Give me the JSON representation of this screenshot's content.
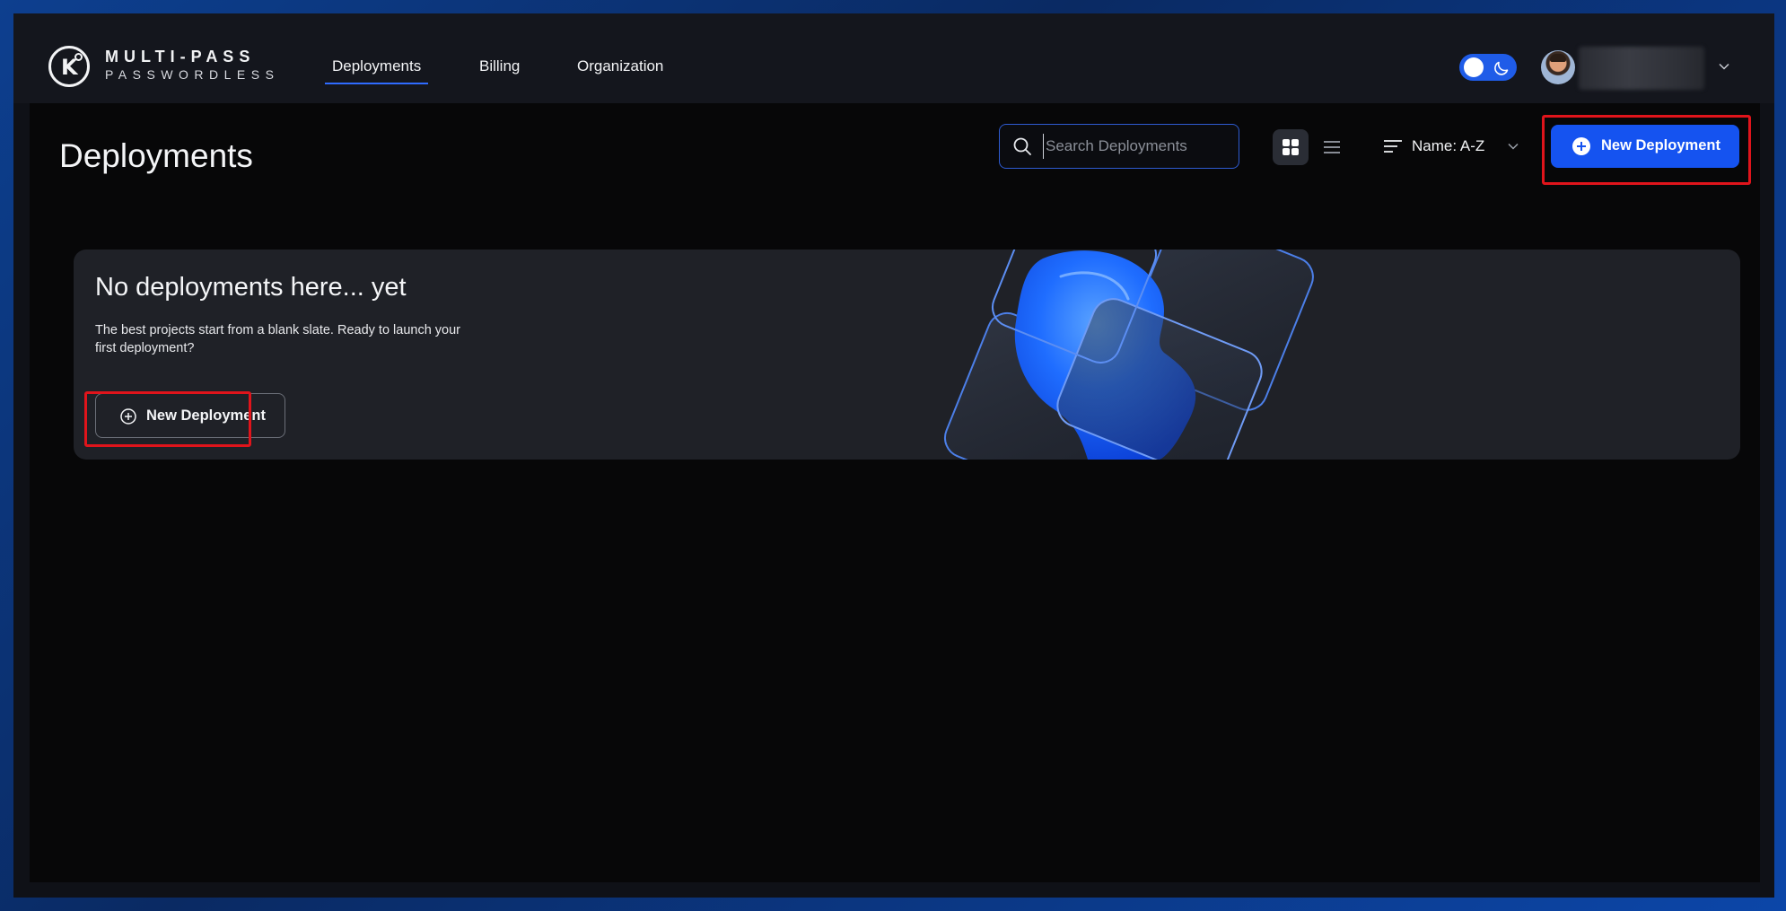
{
  "brand": {
    "title": "MULTI-PASS",
    "subtitle": "PASSWORDLESS"
  },
  "nav": {
    "items": [
      {
        "label": "Deployments",
        "active": true
      },
      {
        "label": "Billing",
        "active": false
      },
      {
        "label": "Organization",
        "active": false
      }
    ]
  },
  "theme_toggle": {
    "state": "dark"
  },
  "page": {
    "title": "Deployments",
    "search": {
      "placeholder": "Search Deployments",
      "value": ""
    },
    "view_mode": "grid",
    "sort": {
      "label": "Name: A-Z"
    },
    "new_button": {
      "label": "New Deployment"
    }
  },
  "empty_state": {
    "title": "No deployments here... yet",
    "description": "The best projects start from a blank slate. Ready to launch your first deployment?",
    "button_label": "New Deployment"
  },
  "colors": {
    "accent": "#1553f0",
    "highlight": "#e0141b",
    "card_bg": "#1f2127",
    "page_bg": "#070708"
  }
}
